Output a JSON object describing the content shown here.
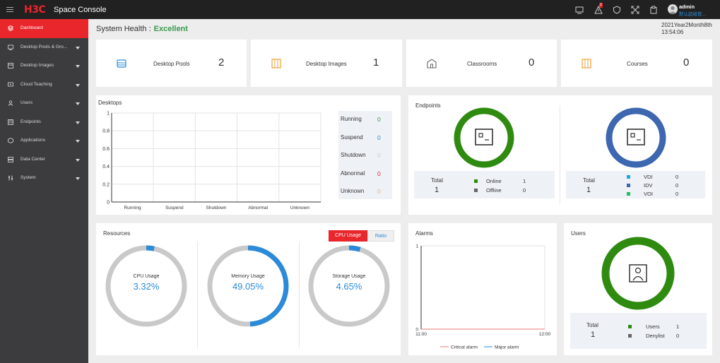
{
  "app": {
    "logo": "H3C",
    "title": "Space Console",
    "alert_badge": "2",
    "user_name": "admin",
    "user_role": "默认超级管..."
  },
  "topbar_icons": [
    "screen-icon",
    "alert-icon",
    "shield-icon",
    "expand-icon",
    "clipboard-icon"
  ],
  "sidebar": {
    "items": [
      {
        "label": "Dashboard",
        "icon": "dashboard-icon",
        "active": true,
        "arrow": false
      },
      {
        "label": "Desktop Pools & Gro...",
        "icon": "desktop-pools-icon",
        "active": false,
        "arrow": true
      },
      {
        "label": "Desktop Images",
        "icon": "desktop-images-icon",
        "active": false,
        "arrow": true
      },
      {
        "label": "Cloud Teaching",
        "icon": "cloud-teaching-icon",
        "active": false,
        "arrow": true
      },
      {
        "label": "Users",
        "icon": "users-icon",
        "active": false,
        "arrow": true
      },
      {
        "label": "Endpoints",
        "icon": "endpoints-icon",
        "active": false,
        "arrow": true
      },
      {
        "label": "Applications",
        "icon": "applications-icon",
        "active": false,
        "arrow": true
      },
      {
        "label": "Data Center",
        "icon": "data-center-icon",
        "active": false,
        "arrow": true
      },
      {
        "label": "System",
        "icon": "system-icon",
        "active": false,
        "arrow": true
      }
    ]
  },
  "health": {
    "label": "System Health :",
    "value": "Excellent"
  },
  "datetime": {
    "date": "2021Year2Month8th",
    "time": "13:54:06"
  },
  "kpis": [
    {
      "label": "Desktop Pools",
      "value": "2",
      "icon": "desktop-pools-icon"
    },
    {
      "label": "Desktop Images",
      "value": "1",
      "icon": "desktop-images-icon"
    },
    {
      "label": "Classrooms",
      "value": "0",
      "icon": "classroom-icon"
    },
    {
      "label": "Courses",
      "value": "0",
      "icon": "courses-icon"
    }
  ],
  "desktops": {
    "title": "Desktops",
    "status": [
      {
        "label": "Running",
        "value": "0",
        "color": "#3b9a4f"
      },
      {
        "label": "Suspend",
        "value": "0",
        "color": "#2b8bd8"
      },
      {
        "label": "Shutdown",
        "value": "0",
        "color": "#c9c9c9"
      },
      {
        "label": "Abnormal",
        "value": "0",
        "color": "#e8262b"
      },
      {
        "label": "Unknown",
        "value": "0",
        "color": "#f0b27a"
      }
    ],
    "chart_data": {
      "type": "bar",
      "categories": [
        "Running",
        "Suspend",
        "Shutdown",
        "Abnormal",
        "Unknown"
      ],
      "values": [
        0,
        0,
        0,
        0,
        0
      ],
      "ylim": [
        0,
        1
      ],
      "yticks": [
        "0",
        "0.2",
        "0.4",
        "0.6",
        "0.8",
        "1"
      ]
    }
  },
  "endpoints": {
    "title": "Endpoints",
    "left": {
      "total_label": "Total",
      "total": "1",
      "ring_color": "#2e8b10",
      "rows": [
        {
          "label": "Online",
          "value": "1",
          "color": "#2e8b10"
        },
        {
          "label": "Offline",
          "value": "0",
          "color": "#666666"
        }
      ]
    },
    "right": {
      "total_label": "Total",
      "total": "1",
      "ring_color": "#3d67b0",
      "rows": [
        {
          "label": "VDI",
          "value": "0",
          "color": "#22a6e0"
        },
        {
          "label": "IDV",
          "value": "0",
          "color": "#3d67b0"
        },
        {
          "label": "VOI",
          "value": "0",
          "color": "#1ebf6a"
        }
      ]
    }
  },
  "resources": {
    "title": "Resources",
    "tabs": [
      {
        "label": "CPU Usage",
        "active": true
      },
      {
        "label": "Ratio",
        "active": false
      }
    ],
    "gauges": [
      {
        "label": "CPU Usage",
        "value": "3.32%",
        "fraction": 0.0332
      },
      {
        "label": "Memory Usage",
        "value": "49.05%",
        "fraction": 0.4905
      },
      {
        "label": "Storage Usage",
        "value": "4.65%",
        "fraction": 0.0465
      }
    ]
  },
  "alarms": {
    "title": "Alarms",
    "chart_data": {
      "type": "line",
      "x": [
        "11:00",
        "12:00"
      ],
      "series": [
        {
          "name": "Critical alarm",
          "values": [
            0,
            0
          ],
          "color": "#e87a7a"
        },
        {
          "name": "Major alarm",
          "values": [
            0,
            0
          ],
          "color": "#2b8bd8"
        }
      ],
      "yticks": [
        "0",
        "1"
      ],
      "ylim": [
        0,
        1
      ]
    }
  },
  "users": {
    "title": "Users",
    "total_label": "Total",
    "total": "1",
    "ring_color": "#2e8b10",
    "rows": [
      {
        "label": "Users",
        "value": "1",
        "color": "#2e8b10"
      },
      {
        "label": "Denylist",
        "value": "0",
        "color": "#666666"
      }
    ]
  },
  "colors": {
    "accent": "#e8262b",
    "blue": "#2b8bd8",
    "green": "#3b9a4f",
    "ring_gray": "#c9c9c9"
  }
}
